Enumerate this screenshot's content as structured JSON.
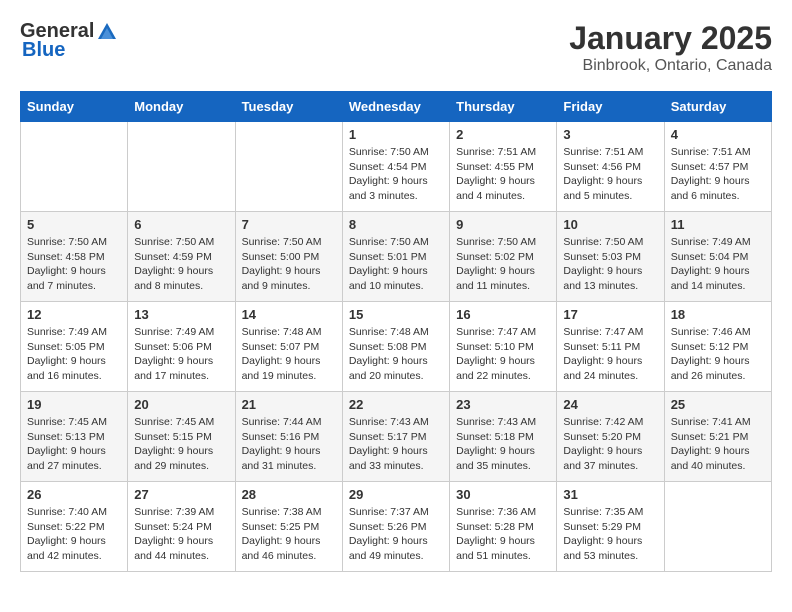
{
  "logo": {
    "general": "General",
    "blue": "Blue"
  },
  "title": "January 2025",
  "location": "Binbrook, Ontario, Canada",
  "headers": [
    "Sunday",
    "Monday",
    "Tuesday",
    "Wednesday",
    "Thursday",
    "Friday",
    "Saturday"
  ],
  "weeks": [
    [
      {
        "day": "",
        "sunrise": "",
        "sunset": "",
        "daylight": ""
      },
      {
        "day": "",
        "sunrise": "",
        "sunset": "",
        "daylight": ""
      },
      {
        "day": "",
        "sunrise": "",
        "sunset": "",
        "daylight": ""
      },
      {
        "day": "1",
        "sunrise": "Sunrise: 7:50 AM",
        "sunset": "Sunset: 4:54 PM",
        "daylight": "Daylight: 9 hours and 3 minutes."
      },
      {
        "day": "2",
        "sunrise": "Sunrise: 7:51 AM",
        "sunset": "Sunset: 4:55 PM",
        "daylight": "Daylight: 9 hours and 4 minutes."
      },
      {
        "day": "3",
        "sunrise": "Sunrise: 7:51 AM",
        "sunset": "Sunset: 4:56 PM",
        "daylight": "Daylight: 9 hours and 5 minutes."
      },
      {
        "day": "4",
        "sunrise": "Sunrise: 7:51 AM",
        "sunset": "Sunset: 4:57 PM",
        "daylight": "Daylight: 9 hours and 6 minutes."
      }
    ],
    [
      {
        "day": "5",
        "sunrise": "Sunrise: 7:50 AM",
        "sunset": "Sunset: 4:58 PM",
        "daylight": "Daylight: 9 hours and 7 minutes."
      },
      {
        "day": "6",
        "sunrise": "Sunrise: 7:50 AM",
        "sunset": "Sunset: 4:59 PM",
        "daylight": "Daylight: 9 hours and 8 minutes."
      },
      {
        "day": "7",
        "sunrise": "Sunrise: 7:50 AM",
        "sunset": "Sunset: 5:00 PM",
        "daylight": "Daylight: 9 hours and 9 minutes."
      },
      {
        "day": "8",
        "sunrise": "Sunrise: 7:50 AM",
        "sunset": "Sunset: 5:01 PM",
        "daylight": "Daylight: 9 hours and 10 minutes."
      },
      {
        "day": "9",
        "sunrise": "Sunrise: 7:50 AM",
        "sunset": "Sunset: 5:02 PM",
        "daylight": "Daylight: 9 hours and 11 minutes."
      },
      {
        "day": "10",
        "sunrise": "Sunrise: 7:50 AM",
        "sunset": "Sunset: 5:03 PM",
        "daylight": "Daylight: 9 hours and 13 minutes."
      },
      {
        "day": "11",
        "sunrise": "Sunrise: 7:49 AM",
        "sunset": "Sunset: 5:04 PM",
        "daylight": "Daylight: 9 hours and 14 minutes."
      }
    ],
    [
      {
        "day": "12",
        "sunrise": "Sunrise: 7:49 AM",
        "sunset": "Sunset: 5:05 PM",
        "daylight": "Daylight: 9 hours and 16 minutes."
      },
      {
        "day": "13",
        "sunrise": "Sunrise: 7:49 AM",
        "sunset": "Sunset: 5:06 PM",
        "daylight": "Daylight: 9 hours and 17 minutes."
      },
      {
        "day": "14",
        "sunrise": "Sunrise: 7:48 AM",
        "sunset": "Sunset: 5:07 PM",
        "daylight": "Daylight: 9 hours and 19 minutes."
      },
      {
        "day": "15",
        "sunrise": "Sunrise: 7:48 AM",
        "sunset": "Sunset: 5:08 PM",
        "daylight": "Daylight: 9 hours and 20 minutes."
      },
      {
        "day": "16",
        "sunrise": "Sunrise: 7:47 AM",
        "sunset": "Sunset: 5:10 PM",
        "daylight": "Daylight: 9 hours and 22 minutes."
      },
      {
        "day": "17",
        "sunrise": "Sunrise: 7:47 AM",
        "sunset": "Sunset: 5:11 PM",
        "daylight": "Daylight: 9 hours and 24 minutes."
      },
      {
        "day": "18",
        "sunrise": "Sunrise: 7:46 AM",
        "sunset": "Sunset: 5:12 PM",
        "daylight": "Daylight: 9 hours and 26 minutes."
      }
    ],
    [
      {
        "day": "19",
        "sunrise": "Sunrise: 7:45 AM",
        "sunset": "Sunset: 5:13 PM",
        "daylight": "Daylight: 9 hours and 27 minutes."
      },
      {
        "day": "20",
        "sunrise": "Sunrise: 7:45 AM",
        "sunset": "Sunset: 5:15 PM",
        "daylight": "Daylight: 9 hours and 29 minutes."
      },
      {
        "day": "21",
        "sunrise": "Sunrise: 7:44 AM",
        "sunset": "Sunset: 5:16 PM",
        "daylight": "Daylight: 9 hours and 31 minutes."
      },
      {
        "day": "22",
        "sunrise": "Sunrise: 7:43 AM",
        "sunset": "Sunset: 5:17 PM",
        "daylight": "Daylight: 9 hours and 33 minutes."
      },
      {
        "day": "23",
        "sunrise": "Sunrise: 7:43 AM",
        "sunset": "Sunset: 5:18 PM",
        "daylight": "Daylight: 9 hours and 35 minutes."
      },
      {
        "day": "24",
        "sunrise": "Sunrise: 7:42 AM",
        "sunset": "Sunset: 5:20 PM",
        "daylight": "Daylight: 9 hours and 37 minutes."
      },
      {
        "day": "25",
        "sunrise": "Sunrise: 7:41 AM",
        "sunset": "Sunset: 5:21 PM",
        "daylight": "Daylight: 9 hours and 40 minutes."
      }
    ],
    [
      {
        "day": "26",
        "sunrise": "Sunrise: 7:40 AM",
        "sunset": "Sunset: 5:22 PM",
        "daylight": "Daylight: 9 hours and 42 minutes."
      },
      {
        "day": "27",
        "sunrise": "Sunrise: 7:39 AM",
        "sunset": "Sunset: 5:24 PM",
        "daylight": "Daylight: 9 hours and 44 minutes."
      },
      {
        "day": "28",
        "sunrise": "Sunrise: 7:38 AM",
        "sunset": "Sunset: 5:25 PM",
        "daylight": "Daylight: 9 hours and 46 minutes."
      },
      {
        "day": "29",
        "sunrise": "Sunrise: 7:37 AM",
        "sunset": "Sunset: 5:26 PM",
        "daylight": "Daylight: 9 hours and 49 minutes."
      },
      {
        "day": "30",
        "sunrise": "Sunrise: 7:36 AM",
        "sunset": "Sunset: 5:28 PM",
        "daylight": "Daylight: 9 hours and 51 minutes."
      },
      {
        "day": "31",
        "sunrise": "Sunrise: 7:35 AM",
        "sunset": "Sunset: 5:29 PM",
        "daylight": "Daylight: 9 hours and 53 minutes."
      },
      {
        "day": "",
        "sunrise": "",
        "sunset": "",
        "daylight": ""
      }
    ]
  ]
}
